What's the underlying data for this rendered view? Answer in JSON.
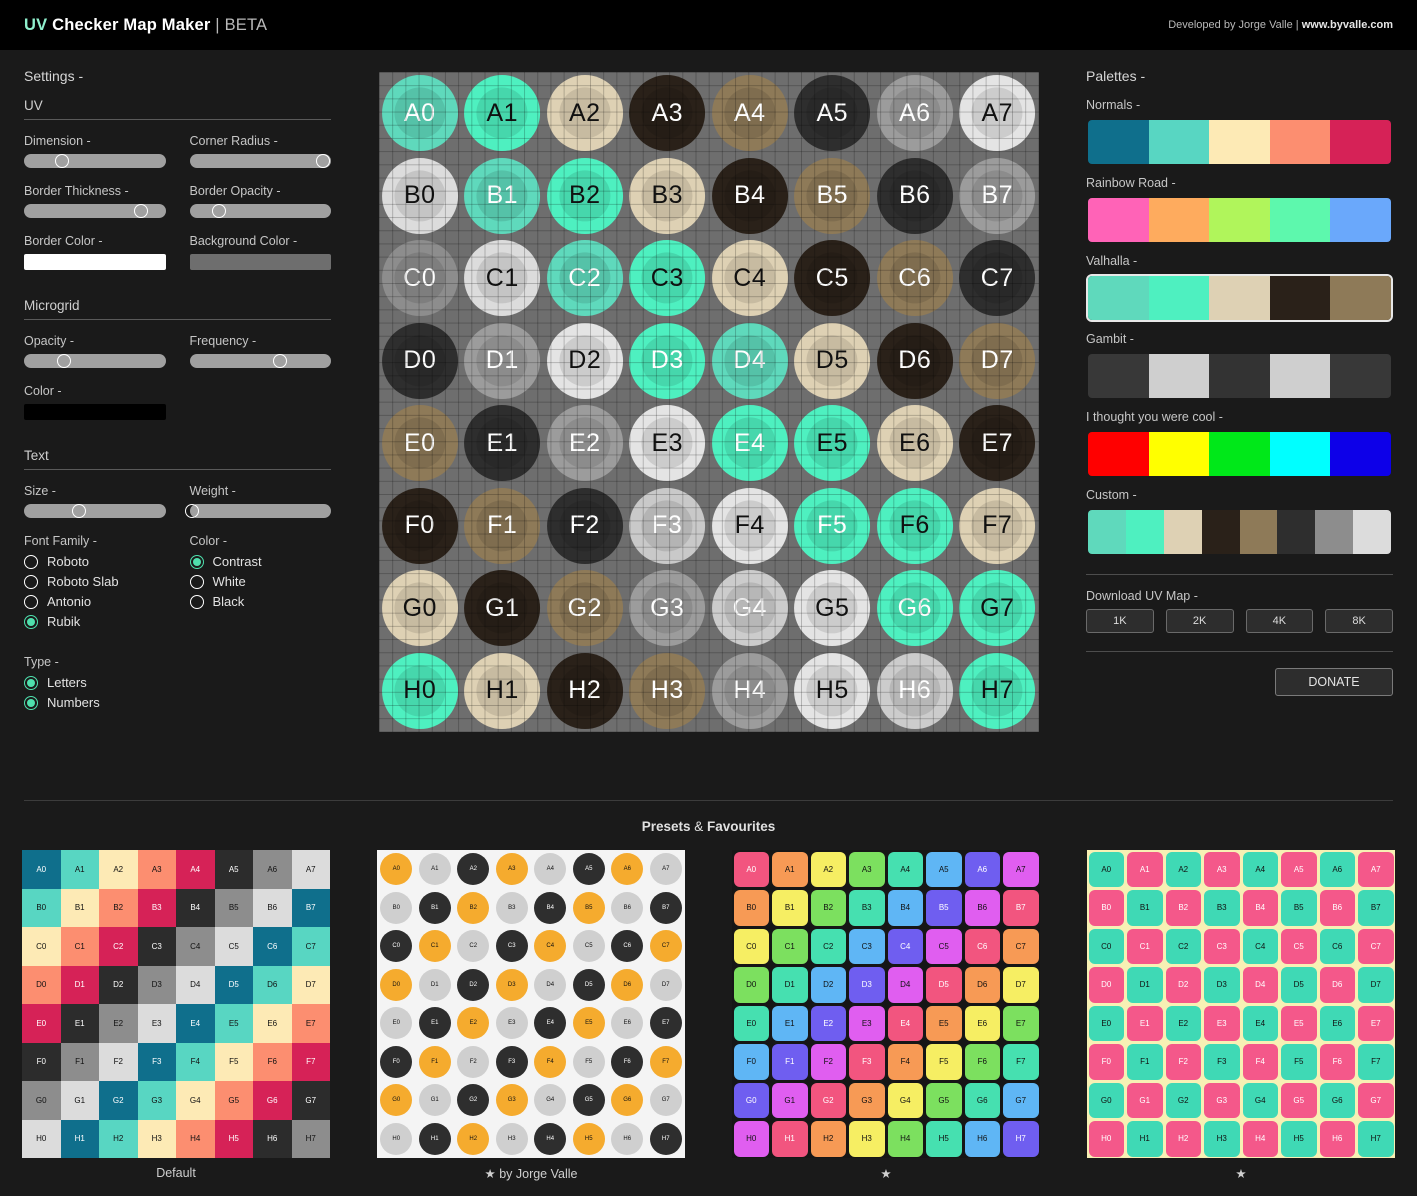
{
  "header": {
    "brand_uv": "UV",
    "brand_rest": " Checker Map Maker ",
    "brand_beta": "| BETA",
    "credit_prefix": "Developed by Jorge Valle | ",
    "credit_site": "www.byvalle.com"
  },
  "settings": {
    "title": "Settings -",
    "uv_head": "UV",
    "microgrid_head": "Microgrid",
    "text_head": "Text",
    "controls": {
      "dimension": {
        "label": "Dimension -",
        "value": 27
      },
      "corner_radius": {
        "label": "Corner Radius -",
        "value": 94
      },
      "border_thickness": {
        "label": "Border Thickness -",
        "value": 83
      },
      "border_opacity": {
        "label": "Border Opacity -",
        "value": 21
      },
      "border_color": {
        "label": "Border Color -",
        "color": "#ffffff"
      },
      "background_color": {
        "label": "Background Color -",
        "color": "#6e6e6e"
      },
      "mg_opacity": {
        "label": "Opacity -",
        "value": 28
      },
      "mg_frequency": {
        "label": "Frequency -",
        "value": 64
      },
      "mg_color": {
        "label": "Color -",
        "color": "#000000"
      },
      "text_size": {
        "label": "Size -",
        "value": 39
      },
      "text_weight": {
        "label": "Weight -",
        "value": 2
      }
    },
    "font_family": {
      "label": "Font Family -",
      "options": [
        "Roboto",
        "Roboto Slab",
        "Antonio",
        "Rubik"
      ],
      "selected": "Rubik"
    },
    "text_color": {
      "label": "Color -",
      "options": [
        "Contrast",
        "White",
        "Black"
      ],
      "selected": "Contrast"
    },
    "type": {
      "label": "Type -",
      "options": [
        "Letters",
        "Numbers"
      ],
      "selected": [
        "Letters",
        "Numbers"
      ]
    }
  },
  "uv_map": {
    "rows": [
      "A",
      "B",
      "C",
      "D",
      "E",
      "F",
      "G",
      "H"
    ],
    "cols": [
      "0",
      "1",
      "2",
      "3",
      "4",
      "5",
      "6",
      "7"
    ],
    "background": "#6e6e6e",
    "cells": [
      [
        {
          "t": "A0",
          "c": "#5fd9bc",
          "x": "#ffffff"
        },
        {
          "t": "A1",
          "c": "#4ef0c0",
          "x": "#111111"
        },
        {
          "t": "A2",
          "c": "#ded1b4",
          "x": "#111111"
        },
        {
          "t": "A3",
          "c": "#2a2119",
          "x": "#ffffff"
        },
        {
          "t": "A4",
          "c": "#8e7a58",
          "x": "#ffffff"
        },
        {
          "t": "A5",
          "c": "#2e2e2e",
          "x": "#ffffff"
        },
        {
          "t": "A6",
          "c": "#9c9c9c",
          "x": "#ffffff"
        },
        {
          "t": "A7",
          "c": "#e4e4e4",
          "x": "#111111"
        }
      ],
      [
        {
          "t": "B0",
          "c": "#dcdcdc",
          "x": "#111111"
        },
        {
          "t": "B1",
          "c": "#5fd9bc",
          "x": "#ffffff"
        },
        {
          "t": "B2",
          "c": "#4ef0c0",
          "x": "#111111"
        },
        {
          "t": "B3",
          "c": "#ded1b4",
          "x": "#111111"
        },
        {
          "t": "B4",
          "c": "#2a2119",
          "x": "#ffffff"
        },
        {
          "t": "B5",
          "c": "#8e7a58",
          "x": "#ffffff"
        },
        {
          "t": "B6",
          "c": "#2e2e2e",
          "x": "#ffffff"
        },
        {
          "t": "B7",
          "c": "#9c9c9c",
          "x": "#ffffff"
        }
      ],
      [
        {
          "t": "C0",
          "c": "#8d8d8d",
          "x": "#ffffff"
        },
        {
          "t": "C1",
          "c": "#dcdcdc",
          "x": "#111111"
        },
        {
          "t": "C2",
          "c": "#5fd9bc",
          "x": "#ffffff"
        },
        {
          "t": "C3",
          "c": "#4ef0c0",
          "x": "#111111"
        },
        {
          "t": "C4",
          "c": "#ded1b4",
          "x": "#111111"
        },
        {
          "t": "C5",
          "c": "#2a2119",
          "x": "#ffffff"
        },
        {
          "t": "C6",
          "c": "#8e7a58",
          "x": "#ffffff"
        },
        {
          "t": "C7",
          "c": "#2e2e2e",
          "x": "#ffffff"
        }
      ],
      [
        {
          "t": "D0",
          "c": "#2e2e2e",
          "x": "#ffffff"
        },
        {
          "t": "D1",
          "c": "#9c9c9c",
          "x": "#ffffff"
        },
        {
          "t": "D2",
          "c": "#e4e4e4",
          "x": "#111111"
        },
        {
          "t": "D3",
          "c": "#4ef0c0",
          "x": "#ffffff"
        },
        {
          "t": "D4",
          "c": "#5fd9bc",
          "x": "#ffffff"
        },
        {
          "t": "D5",
          "c": "#ded1b4",
          "x": "#111111"
        },
        {
          "t": "D6",
          "c": "#2a2119",
          "x": "#ffffff"
        },
        {
          "t": "D7",
          "c": "#8e7a58",
          "x": "#ffffff"
        }
      ],
      [
        {
          "t": "E0",
          "c": "#8e7a58",
          "x": "#ffffff"
        },
        {
          "t": "E1",
          "c": "#2e2e2e",
          "x": "#ffffff"
        },
        {
          "t": "E2",
          "c": "#9c9c9c",
          "x": "#ffffff"
        },
        {
          "t": "E3",
          "c": "#e4e4e4",
          "x": "#111111"
        },
        {
          "t": "E4",
          "c": "#4ef0c0",
          "x": "#ffffff"
        },
        {
          "t": "E5",
          "c": "#4ef0c0",
          "x": "#111111"
        },
        {
          "t": "E6",
          "c": "#ded1b4",
          "x": "#111111"
        },
        {
          "t": "E7",
          "c": "#2a2119",
          "x": "#ffffff"
        }
      ],
      [
        {
          "t": "F0",
          "c": "#2a2119",
          "x": "#ffffff"
        },
        {
          "t": "F1",
          "c": "#8e7a58",
          "x": "#ffffff"
        },
        {
          "t": "F2",
          "c": "#2e2e2e",
          "x": "#ffffff"
        },
        {
          "t": "F3",
          "c": "#c9c9c9",
          "x": "#ffffff"
        },
        {
          "t": "F4",
          "c": "#e4e4e4",
          "x": "#111111"
        },
        {
          "t": "F5",
          "c": "#4ef0c0",
          "x": "#ffffff"
        },
        {
          "t": "F6",
          "c": "#4ef0c0",
          "x": "#111111"
        },
        {
          "t": "F7",
          "c": "#ded1b4",
          "x": "#111111"
        }
      ],
      [
        {
          "t": "G0",
          "c": "#ded1b4",
          "x": "#111111"
        },
        {
          "t": "G1",
          "c": "#2a2119",
          "x": "#ffffff"
        },
        {
          "t": "G2",
          "c": "#8e7a58",
          "x": "#ffffff"
        },
        {
          "t": "G3",
          "c": "#9c9c9c",
          "x": "#ffffff"
        },
        {
          "t": "G4",
          "c": "#cccccc",
          "x": "#ffffff"
        },
        {
          "t": "G5",
          "c": "#e4e4e4",
          "x": "#111111"
        },
        {
          "t": "G6",
          "c": "#4ef0c0",
          "x": "#ffffff"
        },
        {
          "t": "G7",
          "c": "#4ef0c0",
          "x": "#111111"
        }
      ],
      [
        {
          "t": "H0",
          "c": "#4ef0c0",
          "x": "#111111"
        },
        {
          "t": "H1",
          "c": "#ded1b4",
          "x": "#111111"
        },
        {
          "t": "H2",
          "c": "#2a2119",
          "x": "#ffffff"
        },
        {
          "t": "H3",
          "c": "#8e7a58",
          "x": "#ffffff"
        },
        {
          "t": "H4",
          "c": "#9c9c9c",
          "x": "#ffffff"
        },
        {
          "t": "H5",
          "c": "#e4e4e4",
          "x": "#111111"
        },
        {
          "t": "H6",
          "c": "#cccccc",
          "x": "#ffffff"
        },
        {
          "t": "H7",
          "c": "#4ef0c0",
          "x": "#111111"
        }
      ]
    ]
  },
  "palettes": {
    "title": "Palettes -",
    "items": [
      {
        "label": "Normals -",
        "colors": [
          "#0f6f8c",
          "#58d6c2",
          "#fdeab5",
          "#fc8e70",
          "#d62257"
        ],
        "selected": false
      },
      {
        "label": "Rainbow Road -",
        "colors": [
          "#ff63b7",
          "#feab5e",
          "#b0f55b",
          "#5df8ad",
          "#6aa8fb"
        ],
        "selected": false
      },
      {
        "label": "Valhalla -",
        "colors": [
          "#5fd9bc",
          "#4ef0c0",
          "#ded1b4",
          "#2a2119",
          "#8e7a58"
        ],
        "selected": true
      },
      {
        "label": "Gambit -",
        "colors": [
          "#383838",
          "#cfcfcf",
          "#333333",
          "#cfcfcf",
          "#383838"
        ],
        "selected": false
      },
      {
        "label": "I thought you were cool -",
        "colors": [
          "#ff0000",
          "#ffff00",
          "#00e819",
          "#00ffff",
          "#0d00e8"
        ],
        "selected": false
      },
      {
        "label": "Custom -",
        "colors": [
          "#5fd9bc",
          "#4ef0c0",
          "#ded1b4",
          "#2a2119",
          "#8e7a58",
          "#2e2e2e",
          "#8d8d8d",
          "#dcdcdc"
        ],
        "selected": false
      }
    ],
    "download": {
      "label": "Download UV Map -",
      "buttons": [
        "1K",
        "2K",
        "4K",
        "8K"
      ]
    },
    "donate": "DONATE"
  },
  "presets": {
    "title_a": "Presets",
    "title_amp": " & ",
    "title_b": "Favourites",
    "items": [
      {
        "label": "Default",
        "shape": "square",
        "bg": "#1c1c1c",
        "palette": [
          "#0f6f8c",
          "#58d6c2",
          "#fdeab5",
          "#fc8e70",
          "#d62257",
          "#2c2c2c",
          "#8d8d8d",
          "#dcdcdc"
        ]
      },
      {
        "label": "★ by Jorge Valle",
        "shape": "circle",
        "bg": "#f4f4f4",
        "palette": [
          "#f5ab2e",
          "#cfcfcf",
          "#2e2e2e"
        ]
      },
      {
        "label": "★",
        "shape": "rounded",
        "bg": "#161616",
        "palette": [
          "#f2557f",
          "#f79a55",
          "#f6ee63",
          "#7ce05f",
          "#46e0b0",
          "#5fb6f5",
          "#6f5ef0",
          "#e05ef0"
        ]
      },
      {
        "label": "★",
        "shape": "rounded",
        "bg": "#f7f0b4",
        "palette": [
          "#3fd9b5",
          "#f4588a"
        ]
      }
    ]
  }
}
